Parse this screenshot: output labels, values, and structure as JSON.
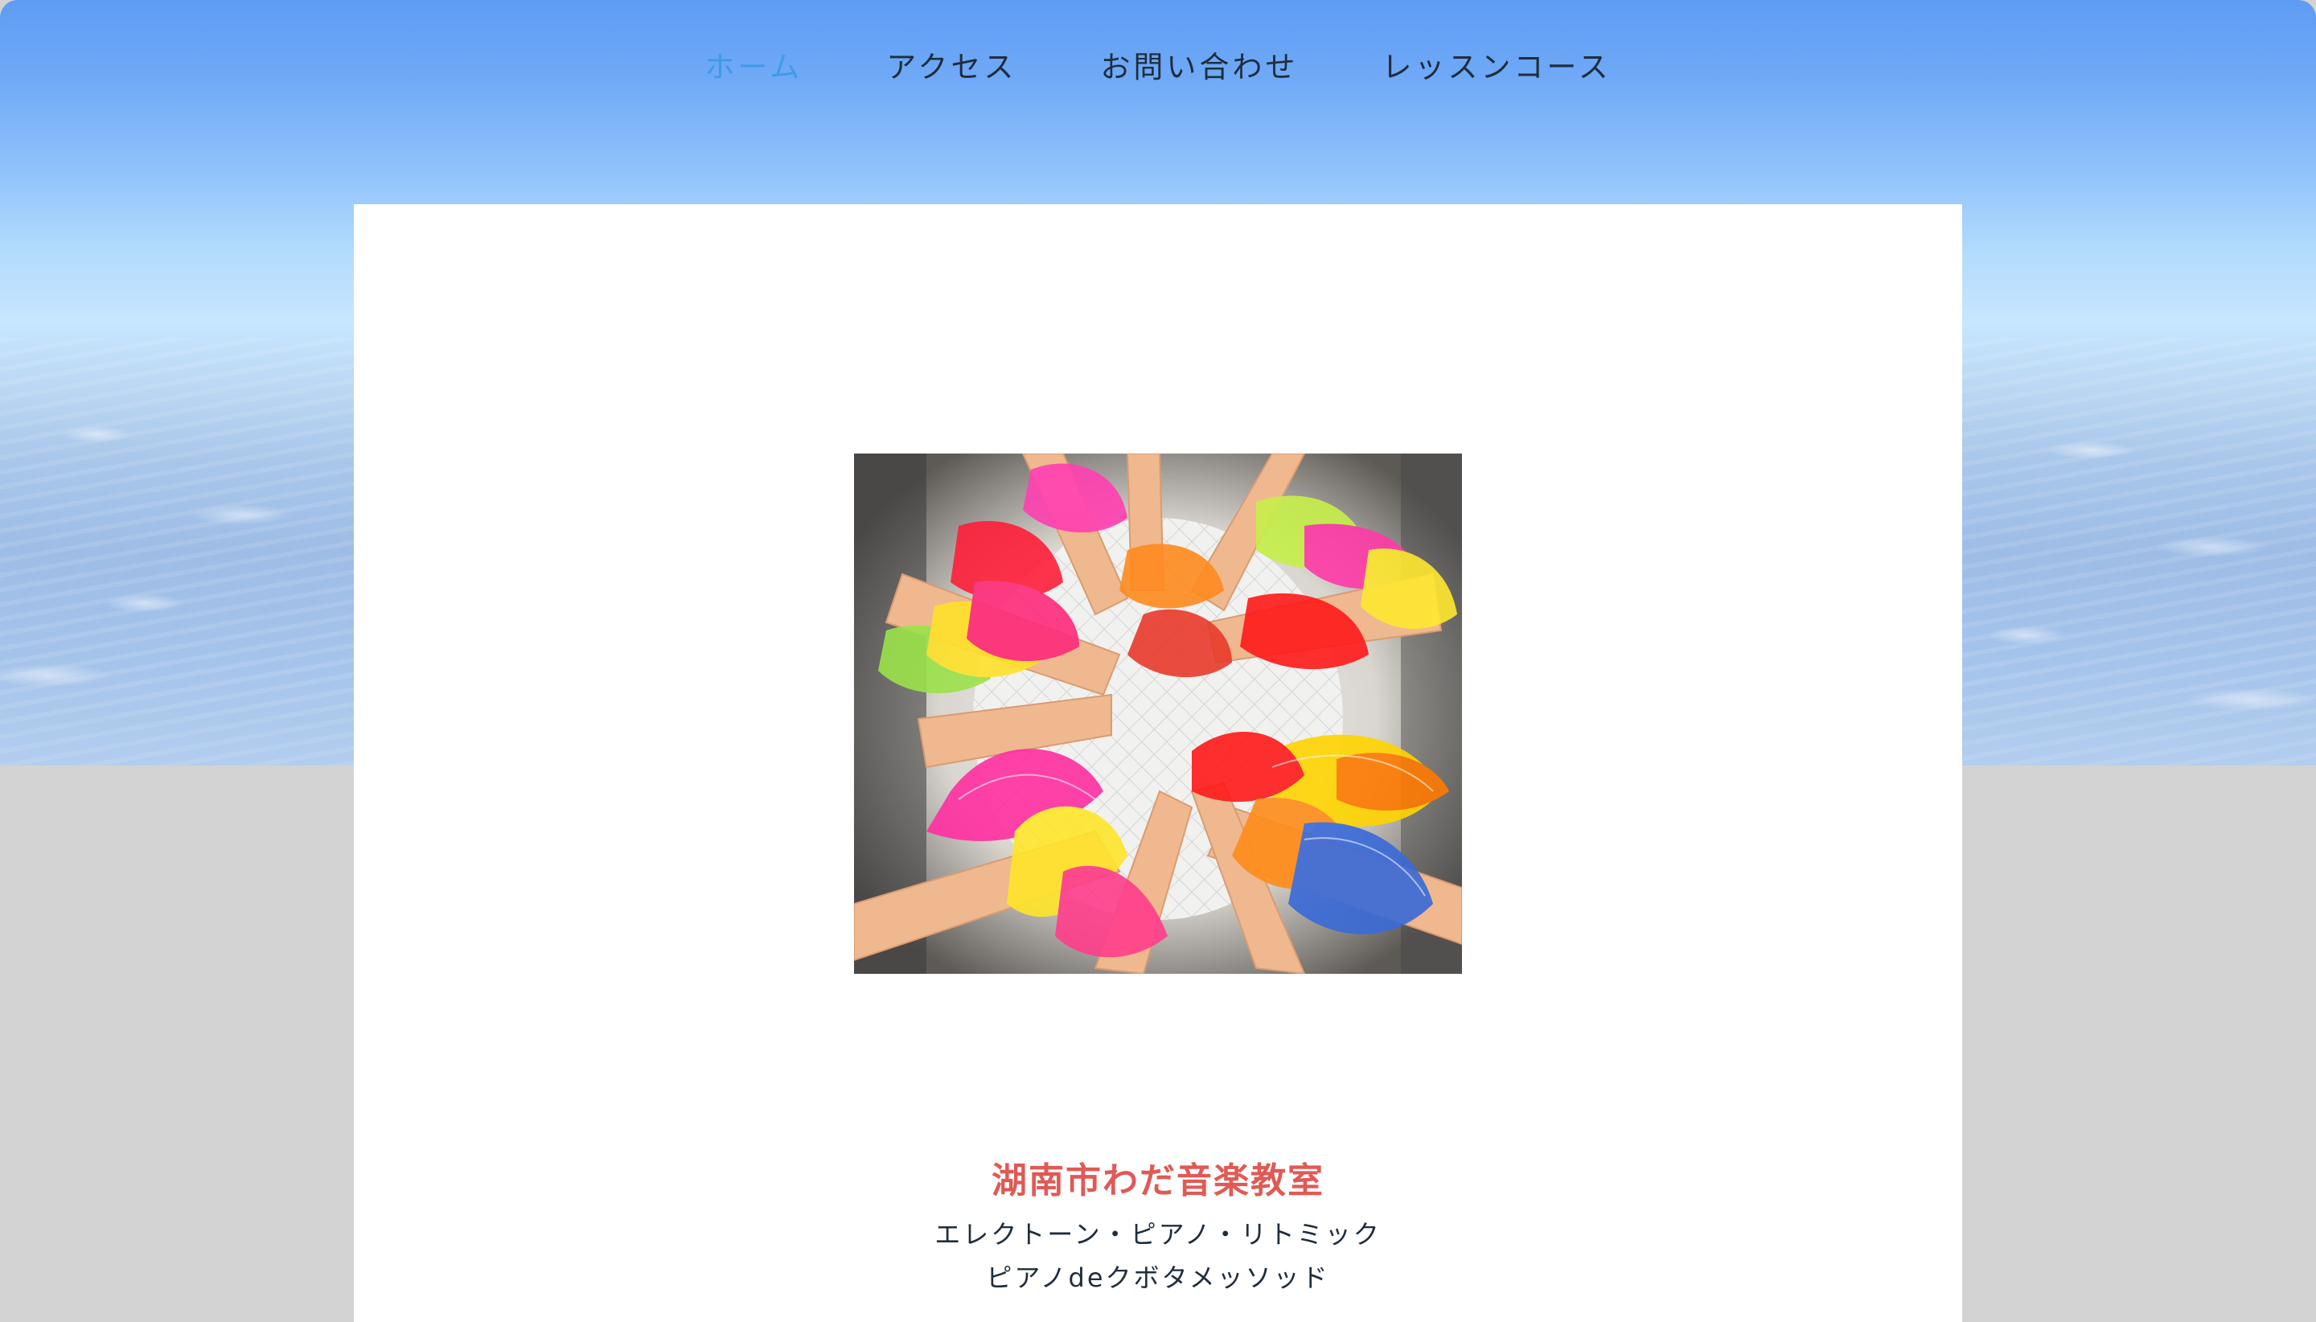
{
  "nav": {
    "items": [
      {
        "label": "ホーム",
        "active": true
      },
      {
        "label": "アクセス",
        "active": false
      },
      {
        "label": "お問い合わせ",
        "active": false
      },
      {
        "label": "レッスンコース",
        "active": false
      }
    ]
  },
  "hero": {
    "image_description_icon": "photo-hands-with-colorful-scarves"
  },
  "site": {
    "title": "湖南市わだ音楽教室",
    "subtitle_line1": "エレクトーン・ピアノ・リトミック",
    "subtitle_line2": "ピアノdeクボタメッソッド"
  },
  "colors": {
    "nav_active": "#3f9be6",
    "nav_text": "#1f2d3d",
    "title": "#e05a55",
    "page_bg": "#d3d3d3"
  }
}
